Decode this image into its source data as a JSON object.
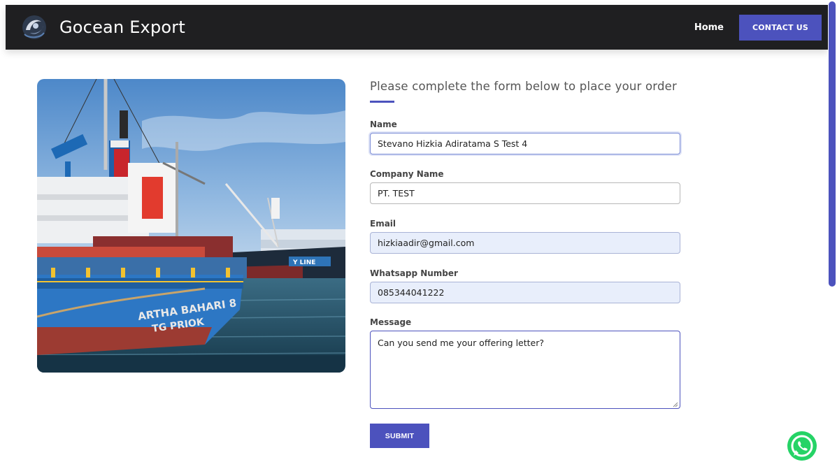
{
  "header": {
    "brand_name": "Gocean Export",
    "nav_home": "Home",
    "nav_contact": "CONTACT US"
  },
  "image": {
    "hull_text_line1": "ARTHA BAHARI 8",
    "hull_text_line2": "TG PRIOK"
  },
  "form": {
    "title": "Please complete the form below to place your order",
    "fields": {
      "name": {
        "label": "Name",
        "value": "Stevano Hizkia Adiratama S Test 4"
      },
      "company": {
        "label": "Company Name",
        "value": "PT. TEST"
      },
      "email": {
        "label": "Email",
        "value": "hizkiaadir@gmail.com"
      },
      "whatsapp": {
        "label": "Whatsapp Number",
        "value": "085344041222"
      },
      "message": {
        "label": "Message",
        "value": "Can you send me your offering letter?"
      }
    },
    "submit_label": "SUBMIT"
  },
  "colors": {
    "accent": "#4c52bd",
    "navbar_bg": "#1f1f21",
    "whatsapp_green": "#25d366"
  },
  "icons": {
    "brand": "gocean-logo-icon",
    "chat": "whatsapp-icon"
  }
}
